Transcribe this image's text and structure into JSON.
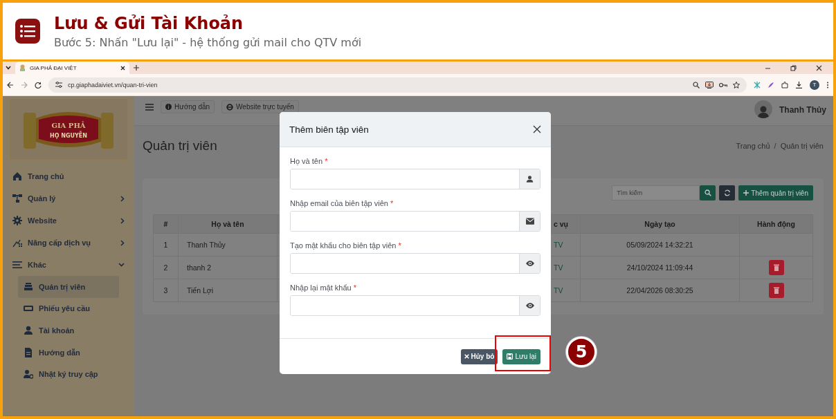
{
  "header": {
    "title": "Lưu & Gửi Tài Khoản",
    "subtitle": "Bước 5: Nhấn \"Lưu lại\" - hệ thống gửi mail cho QTV mới"
  },
  "browser": {
    "tab_title": "GIA PHẢ ĐẠI VIỆT",
    "url": "cp.giaphadaiviet.vn/quan-tri-vien",
    "profile_letter": "T"
  },
  "sidebar": {
    "logo_text": [
      "GIA PHẢ",
      "HỌ NGUYỄN"
    ],
    "items": [
      {
        "label": "Trang chủ",
        "kind": "link"
      },
      {
        "label": "Quản lý",
        "kind": "group",
        "expanded": false
      },
      {
        "label": "Website",
        "kind": "group",
        "expanded": false
      },
      {
        "label": "Nâng cấp dịch vụ",
        "kind": "group",
        "expanded": false
      },
      {
        "label": "Khác",
        "kind": "group",
        "expanded": true,
        "children": [
          {
            "label": "Quản trị viên",
            "selected": true
          },
          {
            "label": "Phiếu yêu cầu",
            "selected": false
          },
          {
            "label": "Tài khoản",
            "selected": false
          },
          {
            "label": "Hướng dẫn",
            "selected": false
          },
          {
            "label": "Nhật ký truy cập",
            "selected": false
          }
        ]
      }
    ]
  },
  "topbar": {
    "buttons": [
      "Hướng dẫn",
      "Website trực tuyến"
    ],
    "user": "Thanh Thủy"
  },
  "page": {
    "title": "Quản trị viên",
    "breadcrumb": [
      "Trang chủ",
      "Quản trị viên"
    ],
    "breadcrumb_separator": "/"
  },
  "toolbar": {
    "search_placeholder": "Tìm kiếm",
    "add_button": "Thêm quản trị viên"
  },
  "table": {
    "columns": [
      "#",
      "Họ và tên",
      "c vụ",
      "Ngày tạo",
      "Hành động"
    ],
    "rows": [
      {
        "number": "1",
        "name": "Thanh Thủy",
        "column_3": "TV",
        "created": "05/09/2024 14:32:21",
        "deletable": false
      },
      {
        "number": "2",
        "name": "thanh 2",
        "column_3": "TV",
        "created": "24/10/2024 11:09:44",
        "deletable": true
      },
      {
        "number": "3",
        "name": "Tiến Lợi",
        "column_3": "TV",
        "created": "22/04/2026 08:30:25",
        "deletable": true
      }
    ]
  },
  "modal": {
    "title": "Thêm biên tập viên",
    "fields": [
      {
        "label": "Họ và tên",
        "required": true,
        "kind": "person"
      },
      {
        "label": "Nhập email của biên tập viên",
        "required": true,
        "kind": "email"
      },
      {
        "label": "Tạo mật khẩu cho biên tập viên",
        "required": true,
        "kind": "password"
      },
      {
        "label": "Nhập lại mật khẩu",
        "required": true,
        "kind": "password"
      }
    ],
    "required_mark": "*",
    "cancel_button": "Hủy bỏ",
    "save_button": "Lưu lại",
    "save_highlighted": true
  },
  "step_badge": "5"
}
